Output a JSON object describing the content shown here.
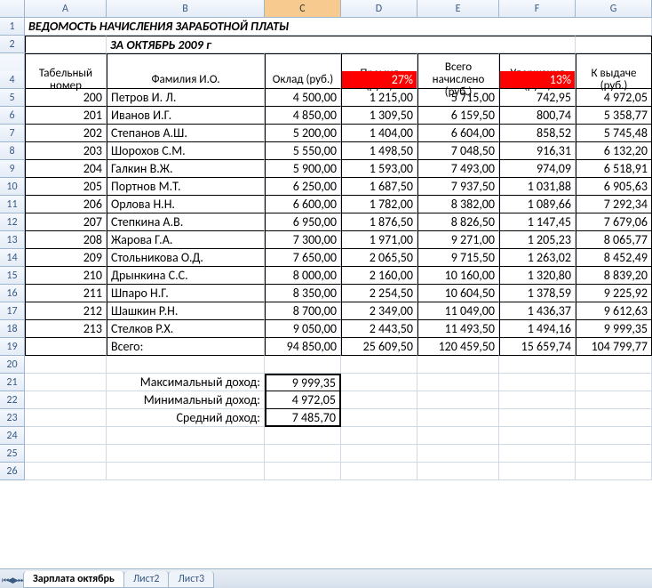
{
  "columns": [
    "A",
    "B",
    "C",
    "D",
    "E",
    "F",
    "G"
  ],
  "selected_col": "C",
  "rowcount": 26,
  "title": "ВЕДОМОСТЬ НАЧИСЛЕНИЯ ЗАРАБОТНОЙ ПЛАТЫ",
  "subtitle": "ЗА ОКТЯБРЬ 2009 г",
  "headers": {
    "a": "Табельный номер",
    "b": "Фамилия И.О.",
    "c": "Оклад (руб.)",
    "d": "Премия (руб.)",
    "e": "Всего начислено (руб.)",
    "f": "Удержания (руб.)",
    "g": "К выдаче (руб.)"
  },
  "rate": {
    "d": "27%",
    "f": "13%"
  },
  "rows": [
    {
      "n": "200",
      "name": "Петров И. Л.",
      "c": "4 500,00",
      "d": "1 215,00",
      "e": "5 715,00",
      "f": "742,95",
      "g": "4 972,05"
    },
    {
      "n": "201",
      "name": "Иванов И.Г.",
      "c": "4 850,00",
      "d": "1 309,50",
      "e": "6 159,50",
      "f": "800,74",
      "g": "5 358,77"
    },
    {
      "n": "202",
      "name": "Степанов А.Ш.",
      "c": "5 200,00",
      "d": "1 404,00",
      "e": "6 604,00",
      "f": "858,52",
      "g": "5 745,48"
    },
    {
      "n": "203",
      "name": "Шорохов С.М.",
      "c": "5 550,00",
      "d": "1 498,50",
      "e": "7 048,50",
      "f": "916,31",
      "g": "6 132,20"
    },
    {
      "n": "204",
      "name": "Галкин В.Ж.",
      "c": "5 900,00",
      "d": "1 593,00",
      "e": "7 493,00",
      "f": "974,09",
      "g": "6 518,91"
    },
    {
      "n": "205",
      "name": "Портнов М.Т.",
      "c": "6 250,00",
      "d": "1 687,50",
      "e": "7 937,50",
      "f": "1 031,88",
      "g": "6 905,63"
    },
    {
      "n": "206",
      "name": "Орлова Н.Н.",
      "c": "6 600,00",
      "d": "1 782,00",
      "e": "8 382,00",
      "f": "1 089,66",
      "g": "7 292,34"
    },
    {
      "n": "207",
      "name": "Степкина А.В.",
      "c": "6 950,00",
      "d": "1 876,50",
      "e": "8 826,50",
      "f": "1 147,45",
      "g": "7 679,06"
    },
    {
      "n": "208",
      "name": "Жарова Г.А.",
      "c": "7 300,00",
      "d": "1 971,00",
      "e": "9 271,00",
      "f": "1 205,23",
      "g": "8 065,77"
    },
    {
      "n": "209",
      "name": "Стольникова О.Д.",
      "c": "7 650,00",
      "d": "2 065,50",
      "e": "9 715,50",
      "f": "1 263,02",
      "g": "8 452,49"
    },
    {
      "n": "210",
      "name": "Дрынкина С.С.",
      "c": "8 000,00",
      "d": "2 160,00",
      "e": "10 160,00",
      "f": "1 320,80",
      "g": "8 839,20"
    },
    {
      "n": "211",
      "name": "Шпаро Н.Г.",
      "c": "8 350,00",
      "d": "2 254,50",
      "e": "10 604,50",
      "f": "1 378,59",
      "g": "9 225,92"
    },
    {
      "n": "212",
      "name": "Шашкин Р.Н.",
      "c": "8 700,00",
      "d": "2 349,00",
      "e": "11 049,00",
      "f": "1 436,37",
      "g": "9 612,63"
    },
    {
      "n": "213",
      "name": "Стелков Р.Х.",
      "c": "9 050,00",
      "d": "2 443,50",
      "e": "11 493,50",
      "f": "1 494,16",
      "g": "9 999,35"
    }
  ],
  "totals": {
    "label": "Всего:",
    "c": "94 850,00",
    "d": "25 609,50",
    "e": "120 459,50",
    "f": "15 659,74",
    "g": "104 799,77"
  },
  "stats": {
    "max_label": "Максимальный доход:",
    "max": "9 999,35",
    "min_label": "Минимальный доход:",
    "min": "4 972,05",
    "avg_label": "Средний доход:",
    "avg": "7 485,70"
  },
  "tabs": [
    "Зарплата октябрь",
    "Лист2",
    "Лист3"
  ],
  "active_tab": 0,
  "chart_data": {
    "type": "table",
    "title": "ВЕДОМОСТЬ НАЧИСЛЕНИЯ ЗАРАБОТНОЙ ПЛАТЫ ЗА ОКТЯБРЬ 2009 г",
    "columns": [
      "Табельный номер",
      "Фамилия И.О.",
      "Оклад (руб.)",
      "Премия (руб.)",
      "Всего начислено (руб.)",
      "Удержания (руб.)",
      "К выдаче (руб.)"
    ],
    "premium_rate_pct": 27,
    "withholding_rate_pct": 13,
    "records": [
      {
        "id": 200,
        "name": "Петров И. Л.",
        "salary": 4500.0,
        "bonus": 1215.0,
        "accrued": 5715.0,
        "withheld": 742.95,
        "payout": 4972.05
      },
      {
        "id": 201,
        "name": "Иванов И.Г.",
        "salary": 4850.0,
        "bonus": 1309.5,
        "accrued": 6159.5,
        "withheld": 800.74,
        "payout": 5358.77
      },
      {
        "id": 202,
        "name": "Степанов А.Ш.",
        "salary": 5200.0,
        "bonus": 1404.0,
        "accrued": 6604.0,
        "withheld": 858.52,
        "payout": 5745.48
      },
      {
        "id": 203,
        "name": "Шорохов С.М.",
        "salary": 5550.0,
        "bonus": 1498.5,
        "accrued": 7048.5,
        "withheld": 916.31,
        "payout": 6132.2
      },
      {
        "id": 204,
        "name": "Галкин В.Ж.",
        "salary": 5900.0,
        "bonus": 1593.0,
        "accrued": 7493.0,
        "withheld": 974.09,
        "payout": 6518.91
      },
      {
        "id": 205,
        "name": "Портнов М.Т.",
        "salary": 6250.0,
        "bonus": 1687.5,
        "accrued": 7937.5,
        "withheld": 1031.88,
        "payout": 6905.63
      },
      {
        "id": 206,
        "name": "Орлова Н.Н.",
        "salary": 6600.0,
        "bonus": 1782.0,
        "accrued": 8382.0,
        "withheld": 1089.66,
        "payout": 7292.34
      },
      {
        "id": 207,
        "name": "Степкина А.В.",
        "salary": 6950.0,
        "bonus": 1876.5,
        "accrued": 8826.5,
        "withheld": 1147.45,
        "payout": 7679.06
      },
      {
        "id": 208,
        "name": "Жарова Г.А.",
        "salary": 7300.0,
        "bonus": 1971.0,
        "accrued": 9271.0,
        "withheld": 1205.23,
        "payout": 8065.77
      },
      {
        "id": 209,
        "name": "Стольникова О.Д.",
        "salary": 7650.0,
        "bonus": 2065.5,
        "accrued": 9715.5,
        "withheld": 1263.02,
        "payout": 8452.49
      },
      {
        "id": 210,
        "name": "Дрынкина С.С.",
        "salary": 8000.0,
        "bonus": 2160.0,
        "accrued": 10160.0,
        "withheld": 1320.8,
        "payout": 8839.2
      },
      {
        "id": 211,
        "name": "Шпаро Н.Г.",
        "salary": 8350.0,
        "bonus": 2254.5,
        "accrued": 10604.5,
        "withheld": 1378.59,
        "payout": 9225.92
      },
      {
        "id": 212,
        "name": "Шашкин Р.Н.",
        "salary": 8700.0,
        "bonus": 2349.0,
        "accrued": 11049.0,
        "withheld": 1436.37,
        "payout": 9612.63
      },
      {
        "id": 213,
        "name": "Стелков Р.Х.",
        "salary": 9050.0,
        "bonus": 2443.5,
        "accrued": 11493.5,
        "withheld": 1494.16,
        "payout": 9999.35
      }
    ],
    "totals": {
      "salary": 94850.0,
      "bonus": 25609.5,
      "accrued": 120459.5,
      "withheld": 15659.74,
      "payout": 104799.77
    },
    "max_payout": 9999.35,
    "min_payout": 4972.05,
    "avg_payout": 7485.7
  }
}
